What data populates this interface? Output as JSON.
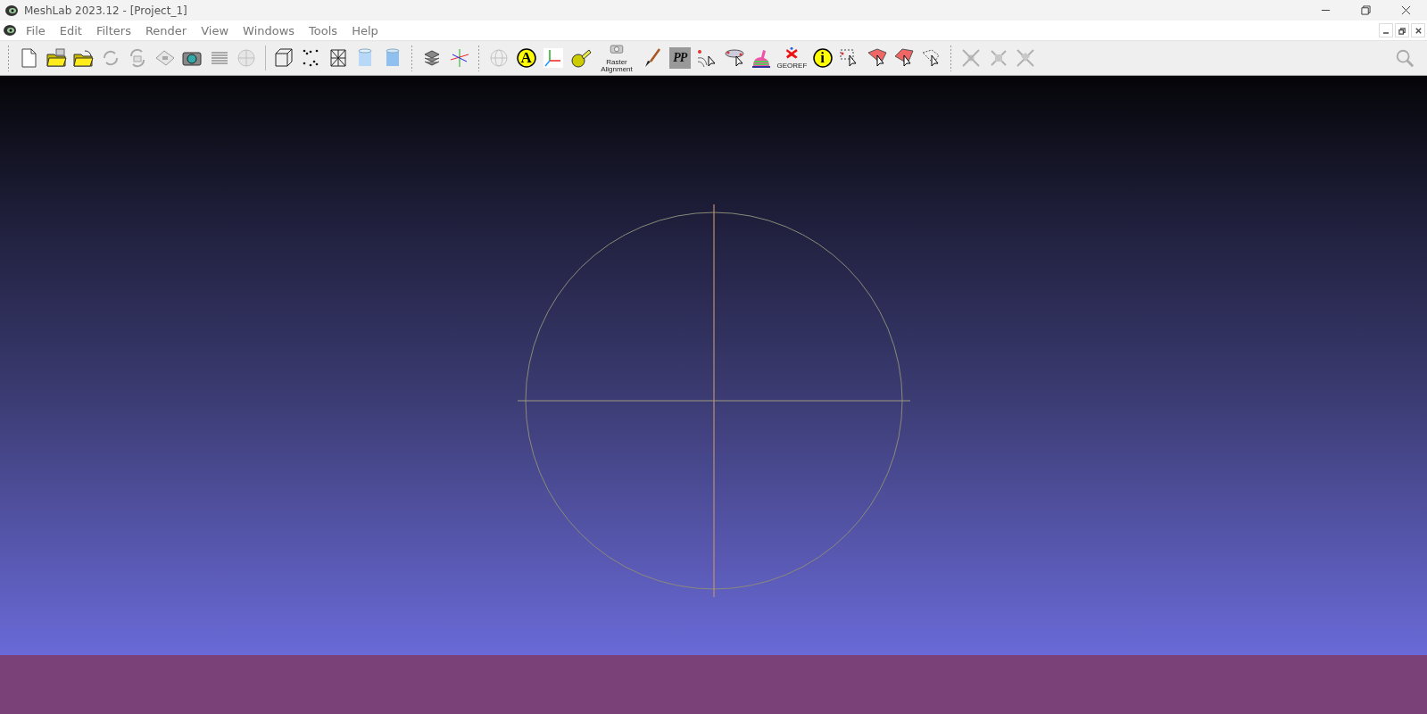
{
  "window": {
    "title": "MeshLab 2023.12 - [Project_1]"
  },
  "menu": [
    {
      "label": "File"
    },
    {
      "label": "Edit"
    },
    {
      "label": "Filters"
    },
    {
      "label": "Render"
    },
    {
      "label": "View"
    },
    {
      "label": "Windows"
    },
    {
      "label": "Tools"
    },
    {
      "label": "Help"
    }
  ],
  "toolbars": [
    {
      "items": [
        {
          "disabled": false
        },
        {
          "disabled": false
        },
        {
          "disabled": false
        },
        {
          "disabled": true
        },
        {
          "disabled": true
        },
        {
          "disabled": true
        },
        {
          "disabled": false
        },
        {
          "disabled": true
        },
        {
          "disabled": true
        }
      ]
    },
    {
      "items": [
        {
          "disabled": false
        },
        {
          "disabled": false
        },
        {
          "disabled": false
        },
        {
          "disabled": false
        },
        {
          "disabled": false
        }
      ]
    },
    {
      "items": [
        {
          "disabled": false
        },
        {
          "disabled": false
        }
      ]
    },
    {
      "items": [
        {
          "disabled": true
        },
        {
          "disabled": false,
          "glyph": "A"
        },
        {
          "disabled": false
        },
        {
          "disabled": false
        },
        {
          "disabled": false,
          "caption": "Raster Alignment"
        },
        {
          "disabled": false
        },
        {
          "disabled": false,
          "glyph": "PP"
        },
        {
          "disabled": false
        },
        {
          "disabled": false
        },
        {
          "disabled": false
        },
        {
          "disabled": false,
          "caption": "GEOREF"
        },
        {
          "disabled": false,
          "glyph": "i"
        },
        {
          "disabled": false
        },
        {
          "disabled": false
        },
        {
          "disabled": false
        },
        {
          "disabled": false
        }
      ]
    },
    {
      "items": [
        {
          "disabled": true
        },
        {
          "disabled": true
        },
        {
          "disabled": true
        }
      ]
    }
  ]
}
